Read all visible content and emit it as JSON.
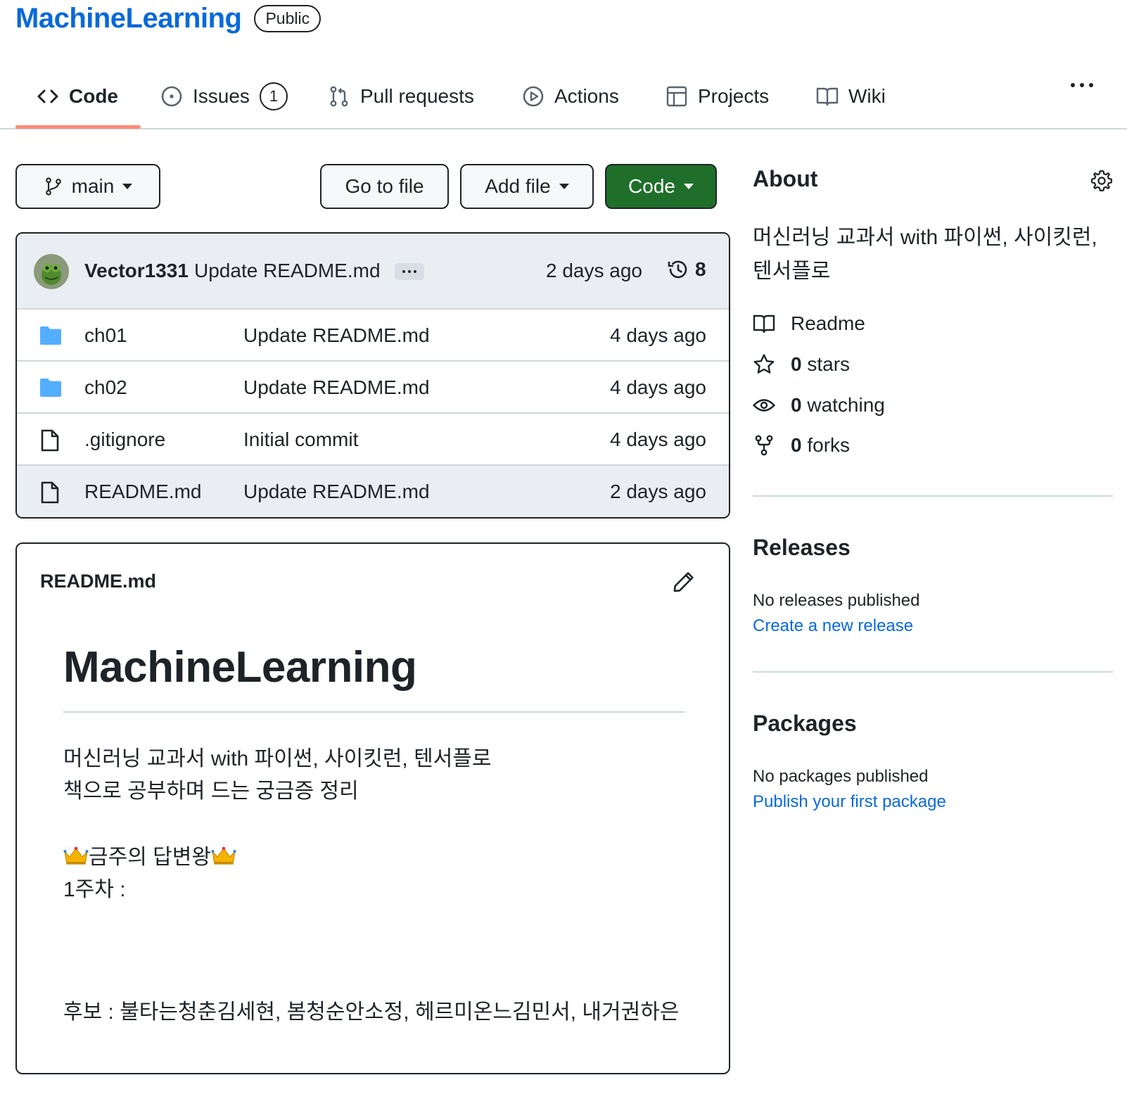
{
  "repo": {
    "name": "MachineLearning",
    "visibility": "Public"
  },
  "tabs": [
    {
      "label": "Code",
      "icon": "code-icon",
      "selected": true
    },
    {
      "label": "Issues",
      "icon": "issue-opened-icon",
      "count": "1"
    },
    {
      "label": "Pull requests",
      "icon": "git-pull-request-icon"
    },
    {
      "label": "Actions",
      "icon": "play-icon"
    },
    {
      "label": "Projects",
      "icon": "table-icon"
    },
    {
      "label": "Wiki",
      "icon": "book-icon"
    }
  ],
  "toolbar": {
    "branch": "main",
    "go_to_file": "Go to file",
    "add_file": "Add file",
    "code": "Code"
  },
  "latest_commit": {
    "author": "Vector1331",
    "message": "Update README.md",
    "time": "2 days ago",
    "commit_count": "8"
  },
  "files": [
    {
      "name": "ch01",
      "type": "folder",
      "commit": "Update README.md",
      "time": "4 days ago"
    },
    {
      "name": "ch02",
      "type": "folder",
      "commit": "Update README.md",
      "time": "4 days ago"
    },
    {
      "name": ".gitignore",
      "type": "file",
      "commit": "Initial commit",
      "time": "4 days ago"
    },
    {
      "name": "README.md",
      "type": "file",
      "commit": "Update README.md",
      "time": "2 days ago"
    }
  ],
  "readme": {
    "filename": "README.md",
    "title": "MachineLearning",
    "line1": "머신러닝 교과서 with 파이썬, 사이킷런, 텐서플로",
    "line2": "책으로 공부하며 드는 궁금증 정리",
    "champion": "금주의 답변왕",
    "week1": "1주차 :",
    "candidates": "후보 : 불타는청춘김세현, 봄청순안소정, 헤르미온느김민서, 내거권하은"
  },
  "about": {
    "heading": "About",
    "description": "머신러닝 교과서 with 파이썬, 사이킷런, 텐서플로",
    "readme_label": "Readme",
    "stars_count": "0",
    "stars_label": "stars",
    "watching_count": "0",
    "watching_label": "watching",
    "forks_count": "0",
    "forks_label": "forks"
  },
  "releases": {
    "heading": "Releases",
    "status": "No releases published",
    "link": "Create a new release"
  },
  "packages": {
    "heading": "Packages",
    "status": "No packages published",
    "link": "Publish your first package"
  },
  "colors": {
    "link": "#0969da",
    "primary_button": "#1f6f2a",
    "folder": "#54aeff",
    "tab_underline": "#fd8c73"
  }
}
